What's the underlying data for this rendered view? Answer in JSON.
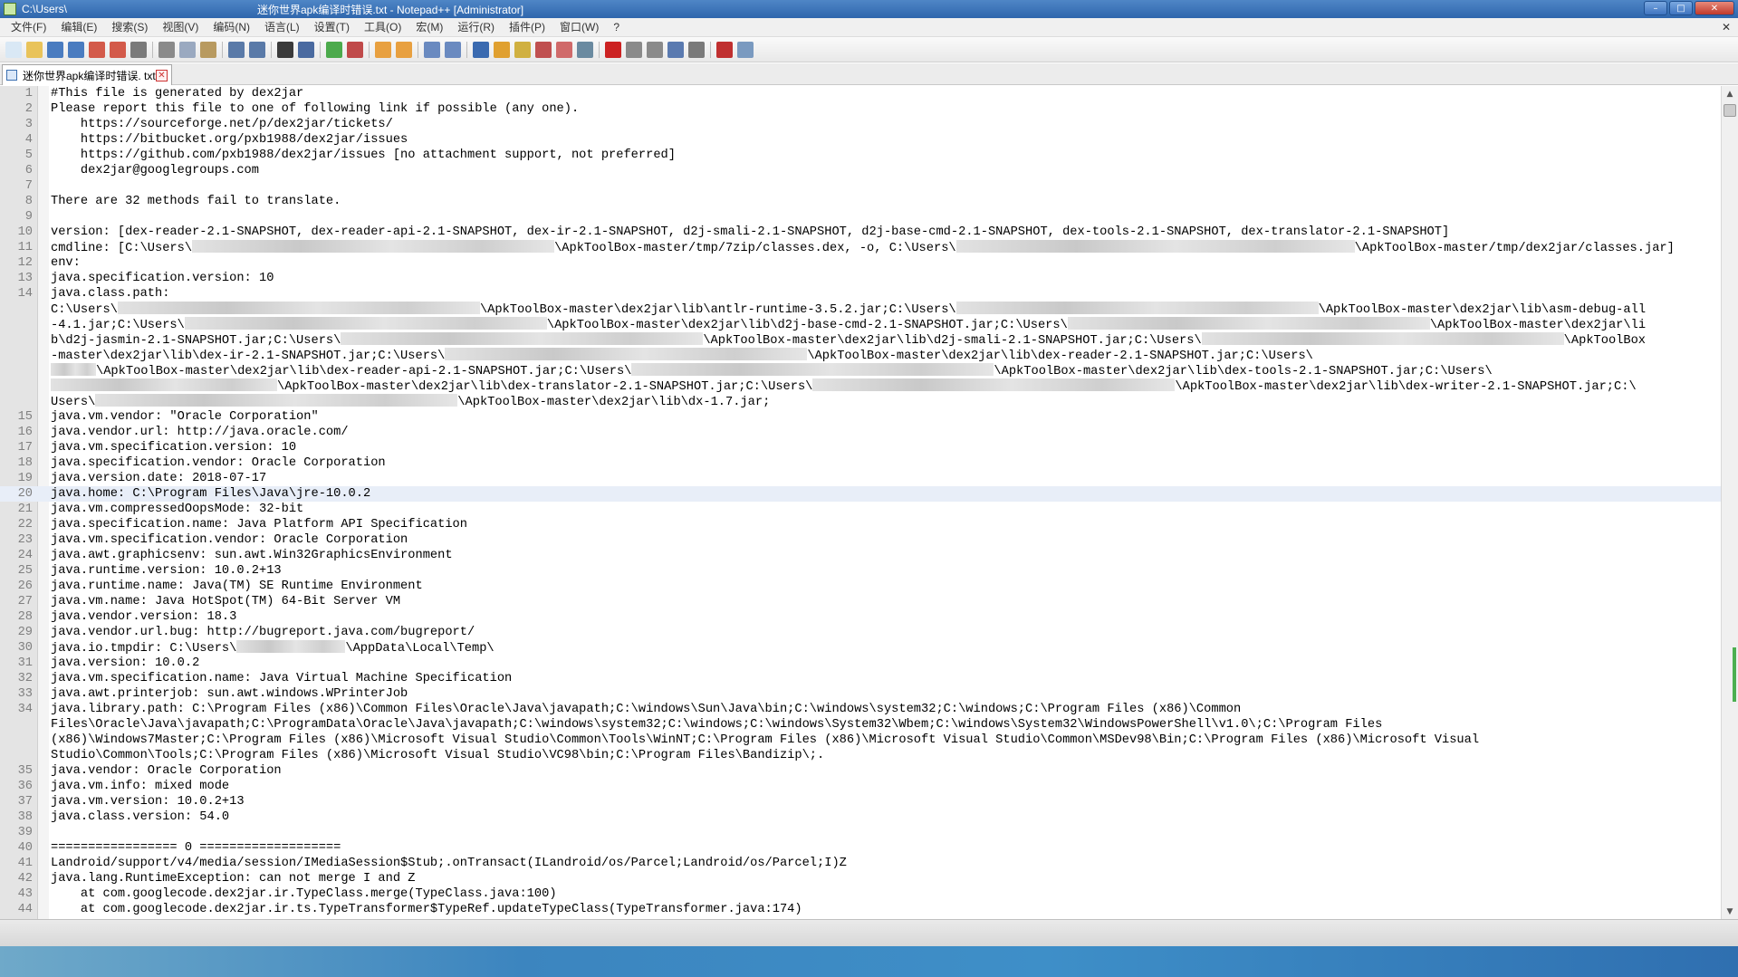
{
  "window": {
    "path": "C:\\Users\\",
    "title": "迷你世界apk编译时错误.txt - Notepad++ [Administrator]",
    "buttons": {
      "minimize": "–",
      "maximize": "□",
      "close": "✕"
    }
  },
  "menu": {
    "items": [
      "文件(F)",
      "编辑(E)",
      "搜索(S)",
      "视图(V)",
      "编码(N)",
      "语言(L)",
      "设置(T)",
      "工具(O)",
      "宏(M)",
      "运行(R)",
      "插件(P)",
      "窗口(W)",
      "?"
    ],
    "close": "✕"
  },
  "toolbar": {
    "icons": [
      {
        "name": "new-file-icon",
        "color": "#d9e8f5"
      },
      {
        "name": "open-file-icon",
        "color": "#e9c35a"
      },
      {
        "name": "save-icon",
        "color": "#4a7cc0"
      },
      {
        "name": "save-all-icon",
        "color": "#4a7cc0"
      },
      {
        "name": "close-icon",
        "color": "#d35a4a"
      },
      {
        "name": "close-all-icon",
        "color": "#d35a4a"
      },
      {
        "name": "print-icon",
        "color": "#7a7a7a"
      },
      {
        "sep": true
      },
      {
        "name": "cut-icon",
        "color": "#8a8a8a"
      },
      {
        "name": "copy-icon",
        "color": "#9aa9c0"
      },
      {
        "name": "paste-icon",
        "color": "#b89a60"
      },
      {
        "sep": true
      },
      {
        "name": "undo-icon",
        "color": "#5a7aa8"
      },
      {
        "name": "redo-icon",
        "color": "#5a7aa8"
      },
      {
        "sep": true
      },
      {
        "name": "find-icon",
        "color": "#3a3a3a"
      },
      {
        "name": "replace-icon",
        "color": "#4a6aa0"
      },
      {
        "sep": true
      },
      {
        "name": "zoom-in-icon",
        "color": "#4caa4c"
      },
      {
        "name": "zoom-out-icon",
        "color": "#c04a4a"
      },
      {
        "sep": true
      },
      {
        "name": "sync-vertical-icon",
        "color": "#e8a040"
      },
      {
        "name": "sync-horizontal-icon",
        "color": "#e8a040"
      },
      {
        "sep": true
      },
      {
        "name": "word-wrap-icon",
        "color": "#6a8ac0"
      },
      {
        "name": "show-all-chars-icon",
        "color": "#6a8ac0"
      },
      {
        "sep": true
      },
      {
        "name": "indent-guide-icon",
        "color": "#3a6ab0"
      },
      {
        "name": "user-lang-icon",
        "color": "#e0a030"
      },
      {
        "name": "doc-map-icon",
        "color": "#d0b040"
      },
      {
        "name": "function-list-icon",
        "color": "#c05050"
      },
      {
        "name": "folder-workspace-icon",
        "color": "#d06a6a"
      },
      {
        "name": "monitor-icon",
        "color": "#6a8aa0"
      },
      {
        "sep": true
      },
      {
        "name": "record-macro-icon",
        "color": "#cc2222"
      },
      {
        "name": "stop-macro-icon",
        "color": "#8a8a8a"
      },
      {
        "name": "play-macro-icon",
        "color": "#8a8a8a"
      },
      {
        "name": "run-macro-multiple-icon",
        "color": "#5a7ab0"
      },
      {
        "name": "save-macro-icon",
        "color": "#7a7a7a"
      },
      {
        "sep": true
      },
      {
        "name": "spell-check-icon",
        "color": "#c03030"
      },
      {
        "name": "panel-icon",
        "color": "#7a9ac0"
      }
    ]
  },
  "tab": {
    "label": "迷你世界apk编译时错误. txt",
    "close": "✕"
  },
  "editor": {
    "current_line": 20,
    "lines": [
      {
        "n": "1",
        "t": "#This file is generated by dex2jar"
      },
      {
        "n": "2",
        "t": "Please report this file to one of following link if possible (any one)."
      },
      {
        "n": "3",
        "t": "    https://sourceforge.net/p/dex2jar/tickets/"
      },
      {
        "n": "4",
        "t": "    https://bitbucket.org/pxb1988/dex2jar/issues"
      },
      {
        "n": "5",
        "t": "    https://github.com/pxb1988/dex2jar/issues [no attachment support, not preferred]"
      },
      {
        "n": "6",
        "t": "    dex2jar@googlegroups.com"
      },
      {
        "n": "7",
        "t": ""
      },
      {
        "n": "8",
        "t": "There are 32 methods fail to translate."
      },
      {
        "n": "9",
        "t": ""
      },
      {
        "n": "10",
        "t": "version: [dex-reader-2.1-SNAPSHOT, dex-reader-api-2.1-SNAPSHOT, dex-ir-2.1-SNAPSHOT, d2j-smali-2.1-SNAPSHOT, d2j-base-cmd-2.1-SNAPSHOT, dex-tools-2.1-SNAPSHOT, dex-translator-2.1-SNAPSHOT]"
      },
      {
        "n": "11",
        "t": "cmdline: [C:\\Users\\",
        "b": 400,
        "t2": "\\ApkToolBox-master/tmp/7zip/classes.dex, -o, C:\\Users\\",
        "b2": 440,
        "t3": "\\ApkToolBox-master/tmp/dex2jar/classes.jar]"
      },
      {
        "n": "12",
        "t": "env:"
      },
      {
        "n": "13",
        "t": "java.specification.version: 10"
      },
      {
        "n": "14",
        "t": "java.class.path:"
      },
      {
        "n": "",
        "t": "C:\\Users\\",
        "b": 400,
        "t2": "\\ApkToolBox-master\\dex2jar\\lib\\antlr-runtime-3.5.2.jar;C:\\Users\\",
        "b2": 400,
        "t3": "\\ApkToolBox-master\\dex2jar\\lib\\asm-debug-all"
      },
      {
        "n": "",
        "t": "-4.1.jar;C:\\Users\\",
        "b": 400,
        "t2": "\\ApkToolBox-master\\dex2jar\\lib\\d2j-base-cmd-2.1-SNAPSHOT.jar;C:\\Users\\",
        "b2": 400,
        "t3": "\\ApkToolBox-master\\dex2jar\\li"
      },
      {
        "n": "",
        "t": "b\\d2j-jasmin-2.1-SNAPSHOT.jar;C:\\Users\\",
        "b": 400,
        "t2": "\\ApkToolBox-master\\dex2jar\\lib\\d2j-smali-2.1-SNAPSHOT.jar;C:\\Users\\",
        "b2": 400,
        "t3": "\\ApkToolBox"
      },
      {
        "n": "",
        "t": "-master\\dex2jar\\lib\\dex-ir-2.1-SNAPSHOT.jar;C:\\Users\\",
        "b": 400,
        "t2": "\\ApkToolBox-master\\dex2jar\\lib\\dex-reader-2.1-SNAPSHOT.jar;C:\\Users\\",
        "b2": 0,
        "t3": ""
      },
      {
        "n": "",
        "t": "",
        "b": 50,
        "t2": "\\ApkToolBox-master\\dex2jar\\lib\\dex-reader-api-2.1-SNAPSHOT.jar;C:\\Users\\",
        "b2": 400,
        "t3": "\\ApkToolBox-master\\dex2jar\\lib\\dex-tools-2.1-SNAPSHOT.jar;C:\\Users\\"
      },
      {
        "n": "",
        "t": "",
        "b": 250,
        "t2": "\\ApkToolBox-master\\dex2jar\\lib\\dex-translator-2.1-SNAPSHOT.jar;C:\\Users\\",
        "b2": 400,
        "t3": "\\ApkToolBox-master\\dex2jar\\lib\\dex-writer-2.1-SNAPSHOT.jar;C:\\"
      },
      {
        "n": "",
        "t": "Users\\",
        "b": 400,
        "t2": "\\ApkToolBox-master\\dex2jar\\lib\\dx-1.7.jar;"
      },
      {
        "n": "15",
        "t": "java.vm.vendor: \"Oracle Corporation\""
      },
      {
        "n": "16",
        "t": "java.vendor.url: http://java.oracle.com/"
      },
      {
        "n": "17",
        "t": "java.vm.specification.version: 10"
      },
      {
        "n": "18",
        "t": "java.specification.vendor: Oracle Corporation"
      },
      {
        "n": "19",
        "t": "java.version.date: 2018-07-17"
      },
      {
        "n": "20",
        "t": "java.home: C:\\Program Files\\Java\\jre-10.0.2"
      },
      {
        "n": "21",
        "t": "java.vm.compressedOopsMode: 32-bit"
      },
      {
        "n": "22",
        "t": "java.specification.name: Java Platform API Specification"
      },
      {
        "n": "23",
        "t": "java.vm.specification.vendor: Oracle Corporation"
      },
      {
        "n": "24",
        "t": "java.awt.graphicsenv: sun.awt.Win32GraphicsEnvironment"
      },
      {
        "n": "25",
        "t": "java.runtime.version: 10.0.2+13"
      },
      {
        "n": "26",
        "t": "java.runtime.name: Java(TM) SE Runtime Environment"
      },
      {
        "n": "27",
        "t": "java.vm.name: Java HotSpot(TM) 64-Bit Server VM"
      },
      {
        "n": "28",
        "t": "java.vendor.version: 18.3"
      },
      {
        "n": "29",
        "t": "java.vendor.url.bug: http://bugreport.java.com/bugreport/"
      },
      {
        "n": "30",
        "t": "java.io.tmpdir: C:\\Users\\",
        "b": 120,
        "t2": "\\AppData\\Local\\Temp\\"
      },
      {
        "n": "31",
        "t": "java.version: 10.0.2"
      },
      {
        "n": "32",
        "t": "java.vm.specification.name: Java Virtual Machine Specification"
      },
      {
        "n": "33",
        "t": "java.awt.printerjob: sun.awt.windows.WPrinterJob"
      },
      {
        "n": "34",
        "t": "java.library.path: C:\\Program Files (x86)\\Common Files\\Oracle\\Java\\javapath;C:\\windows\\Sun\\Java\\bin;C:\\windows\\system32;C:\\windows;C:\\Program Files (x86)\\Common"
      },
      {
        "n": "",
        "t": "Files\\Oracle\\Java\\javapath;C:\\ProgramData\\Oracle\\Java\\javapath;C:\\windows\\system32;C:\\windows;C:\\windows\\System32\\Wbem;C:\\windows\\System32\\WindowsPowerShell\\v1.0\\;C:\\Program Files"
      },
      {
        "n": "",
        "t": "(x86)\\Windows7Master;C:\\Program Files (x86)\\Microsoft Visual Studio\\Common\\Tools\\WinNT;C:\\Program Files (x86)\\Microsoft Visual Studio\\Common\\MSDev98\\Bin;C:\\Program Files (x86)\\Microsoft Visual"
      },
      {
        "n": "",
        "t": "Studio\\Common\\Tools;C:\\Program Files (x86)\\Microsoft Visual Studio\\VC98\\bin;C:\\Program Files\\Bandizip\\;."
      },
      {
        "n": "35",
        "t": "java.vendor: Oracle Corporation"
      },
      {
        "n": "36",
        "t": "java.vm.info: mixed mode"
      },
      {
        "n": "37",
        "t": "java.vm.version: 10.0.2+13"
      },
      {
        "n": "38",
        "t": "java.class.version: 54.0"
      },
      {
        "n": "39",
        "t": ""
      },
      {
        "n": "40",
        "t": "================= 0 ==================="
      },
      {
        "n": "41",
        "t": "Landroid/support/v4/media/session/IMediaSession$Stub;.onTransact(ILandroid/os/Parcel;Landroid/os/Parcel;I)Z"
      },
      {
        "n": "42",
        "t": "java.lang.RuntimeException: can not merge I and Z"
      },
      {
        "n": "43",
        "t": "    at com.googlecode.dex2jar.ir.TypeClass.merge(TypeClass.java:100)"
      },
      {
        "n": "44",
        "t": "    at com.googlecode.dex2jar.ir.ts.TypeTransformer$TypeRef.updateTypeClass(TypeTransformer.java:174)"
      }
    ]
  },
  "scrollbar": {
    "up": "▲",
    "down": "▼"
  }
}
